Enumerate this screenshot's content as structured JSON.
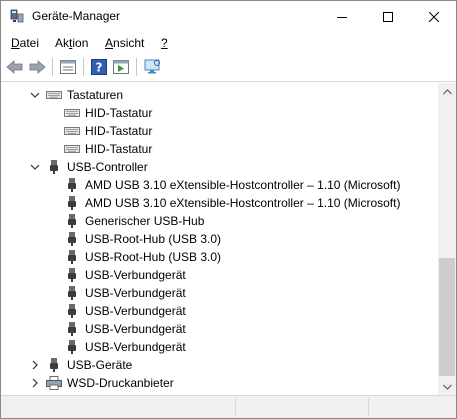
{
  "window": {
    "title": "Geräte-Manager"
  },
  "menu": [
    {
      "label": "Datei",
      "pre": "",
      "ul": "D",
      "post": "atei"
    },
    {
      "label": "Aktion",
      "pre": "Ak",
      "ul": "t",
      "post": "ion"
    },
    {
      "label": "Ansicht",
      "pre": "",
      "ul": "A",
      "post": "nsicht"
    },
    {
      "label": "?",
      "pre": "",
      "ul": "?",
      "post": ""
    }
  ],
  "toolbar": [
    "back-icon",
    "forward-icon",
    "properties-icon",
    "help-icon",
    "run-icon",
    "monitor-scan-icon"
  ],
  "tree": {
    "tastaturen": {
      "label": "Tastaturen",
      "expanded": true,
      "children": [
        "HID-Tastatur",
        "HID-Tastatur",
        "HID-Tastatur"
      ]
    },
    "usb_controller": {
      "label": "USB-Controller",
      "expanded": true,
      "children": [
        "AMD USB 3.10 eXtensible-Hostcontroller – 1.10 (Microsoft)",
        "AMD USB 3.10 eXtensible-Hostcontroller – 1.10 (Microsoft)",
        "Generischer USB-Hub",
        "USB-Root-Hub (USB 3.0)",
        "USB-Root-Hub (USB 3.0)",
        "USB-Verbundgerät",
        "USB-Verbundgerät",
        "USB-Verbundgerät",
        "USB-Verbundgerät",
        "USB-Verbundgerät"
      ]
    },
    "usb_geraete": {
      "label": "USB-Geräte",
      "expanded": false
    },
    "wsd": {
      "label": "WSD-Druckanbieter",
      "expanded": false
    }
  },
  "colors": {
    "accent": "#0078d7",
    "keyboard": "#7a7a7a",
    "usb": "#3c3c3c"
  }
}
